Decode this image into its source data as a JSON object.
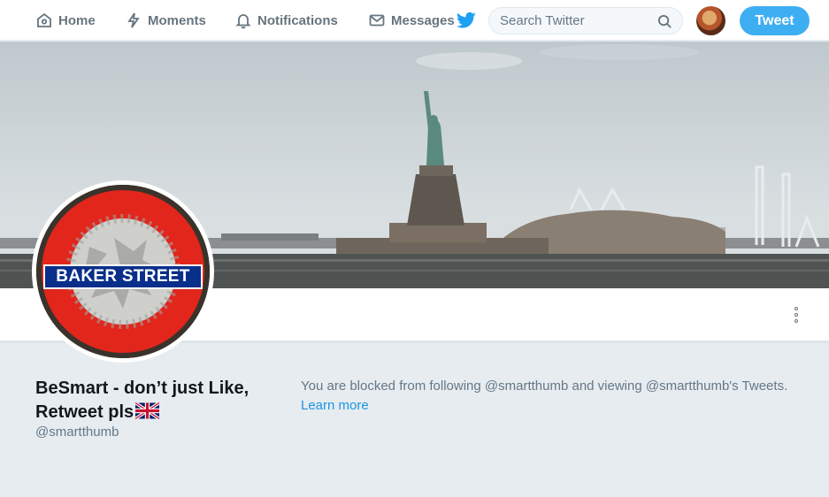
{
  "nav": {
    "home": "Home",
    "moments": "Moments",
    "notifications": "Notifications",
    "messages": "Messages"
  },
  "search": {
    "placeholder": "Search Twitter"
  },
  "tweet_button": "Tweet",
  "banner": {
    "sign": "BAKER STREET"
  },
  "profile": {
    "name": "BeSmart - don’t just Like, Retweet pls",
    "handle": "@smartthumb"
  },
  "blocked": {
    "message": "You are blocked from following @smartthumb and viewing @smartthumb's Tweets.",
    "learn_more": "Learn more"
  },
  "colors": {
    "accent": "#1da1f2",
    "link": "#1b95e0",
    "background": "#e6ecf0"
  },
  "icons": [
    "home-icon",
    "lightning-icon",
    "bell-icon",
    "envelope-icon",
    "twitter-bird-icon",
    "search-icon",
    "more-icon",
    "uk-flag-icon"
  ]
}
